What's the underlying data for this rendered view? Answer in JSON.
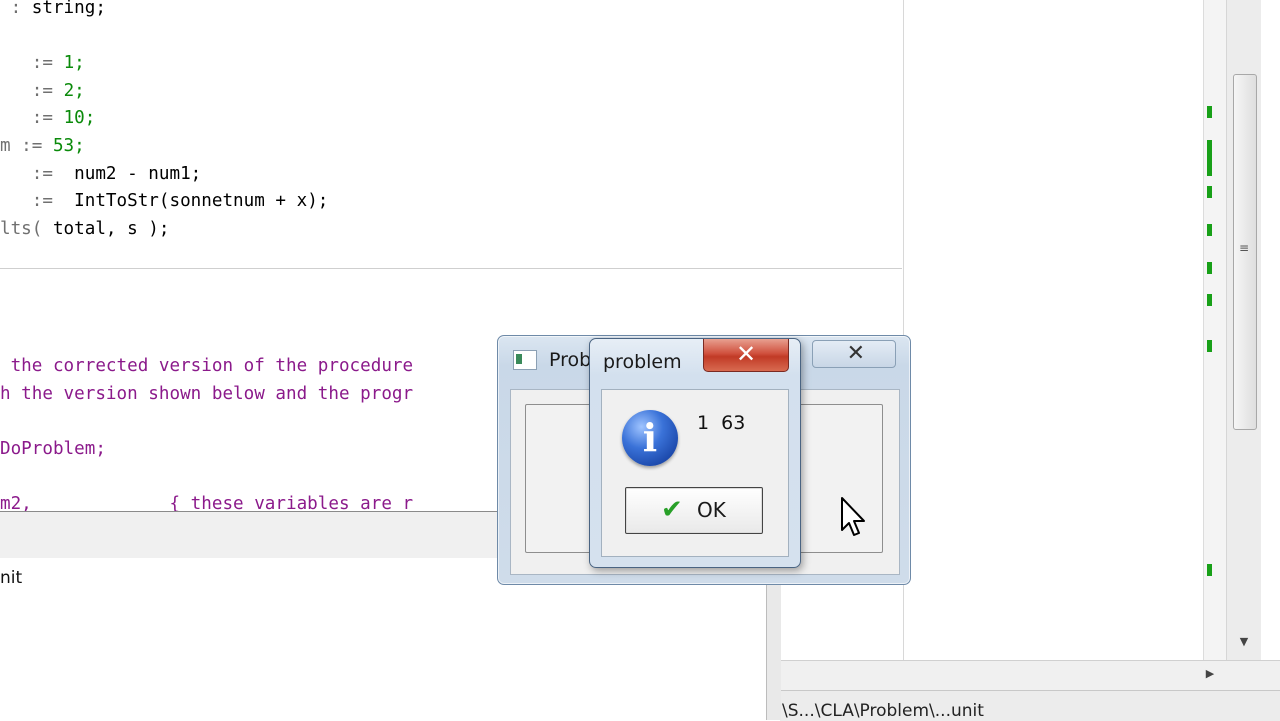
{
  "editor": {
    "upper_lines": [
      {
        "prefix": " : ",
        "code": "string;",
        "style": "kw"
      },
      {
        "prefix": "",
        "code": "",
        "style": "kw"
      },
      {
        "prefix": "   := ",
        "code": "1;",
        "style": "num"
      },
      {
        "prefix": "   := ",
        "code": "2;",
        "style": "num"
      },
      {
        "prefix": "   := ",
        "code": "10;",
        "style": "num"
      },
      {
        "prefix": "m := ",
        "code": "53;",
        "style": "num"
      },
      {
        "prefix": "   :=  ",
        "code": "num2 - num1;",
        "style": "kw"
      },
      {
        "prefix": "   :=  ",
        "code": "IntToStr(sonnetnum + x);",
        "style": "kw"
      },
      {
        "prefix": "lts( ",
        "code": "total, s );",
        "style": "kw"
      }
    ],
    "lower_lines": [
      {
        "text": " the corrected version of the procedure",
        "style": "cmt"
      },
      {
        "text": "h the version shown below and the progr",
        "style": "cmt"
      },
      {
        "text": "",
        "style": "kw"
      },
      {
        "text": "DoProblem;",
        "style": "cmt"
      },
      {
        "text": "",
        "style": "kw"
      },
      {
        "text": "m2,             { these variables are r",
        "style": "cmt"
      }
    ]
  },
  "output_pane": {
    "text": "nit"
  },
  "status": {
    "path": "\\S...\\CLA\\Problem\\...unit"
  },
  "form_window": {
    "title": "Prob",
    "close_glyph": "✕"
  },
  "message_dialog": {
    "title": "problem",
    "close_glyph": "✕",
    "icon": "information-icon",
    "icon_glyph": "i",
    "message": "1  63",
    "ok_label": "OK",
    "ok_glyph": "✔"
  },
  "scrollbars": {
    "down_glyph": "▼",
    "right_glyph": "▶",
    "grip_glyph": "≡"
  },
  "colors": {
    "comment": "#8b1a8b",
    "number": "#0a8a0a",
    "close_red": "#c13a26",
    "marker_green": "#18a018"
  }
}
